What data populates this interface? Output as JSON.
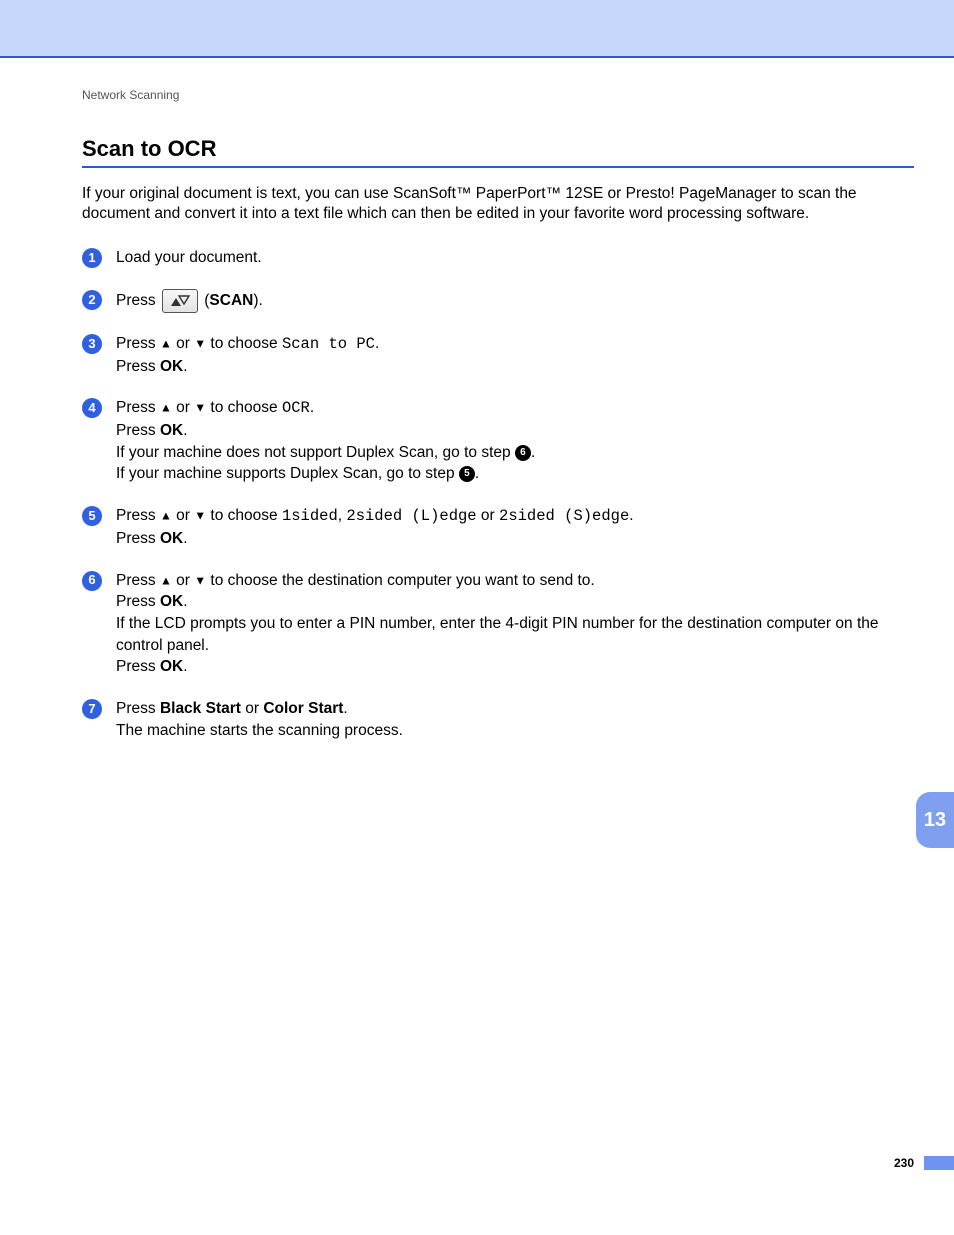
{
  "header": {
    "running_head": "Network Scanning",
    "title": "Scan to OCR"
  },
  "intro": "If your original document is text, you can use ScanSoft™ PaperPort™ 12SE or Presto! PageManager to scan the document and convert it into a text file which can then be edited in your favorite word processing software.",
  "labels": {
    "press": "Press ",
    "or": " or ",
    "choose": " to choose ",
    "ok": "OK",
    "press_ok": "Press ",
    "scan_label": "SCAN",
    "black_start": "Black Start",
    "color_start": "Color Start"
  },
  "options": {
    "scan_to_pc": "Scan to PC",
    "ocr": "OCR",
    "sided1": "1sided",
    "sided2L": "2sided (L)edge",
    "sided2S": "2sided (S)edge"
  },
  "steps": {
    "s1": "Load your document.",
    "s3_tail": ".",
    "s4_dup_no_a": "If your machine does not support Duplex Scan, go to step ",
    "s4_dup_no_ref": "6",
    "s4_dup_no_b": ".",
    "s4_dup_yes_a": "If your machine supports Duplex Scan, go to step ",
    "s4_dup_yes_ref": "5",
    "s4_dup_yes_b": ".",
    "s5_or": " or ",
    "s5_tail": ".",
    "s6_a": " to choose the destination computer you want to send to.",
    "s6_lcd": "If the LCD prompts you to enter a PIN number, enter the 4-digit PIN number for the destination computer on the control panel.",
    "s7_or": " or ",
    "s7_tail": ".",
    "s7_line2": "The machine starts the scanning process."
  },
  "sidebar": {
    "chapter": "13"
  },
  "footer": {
    "page": "230"
  }
}
